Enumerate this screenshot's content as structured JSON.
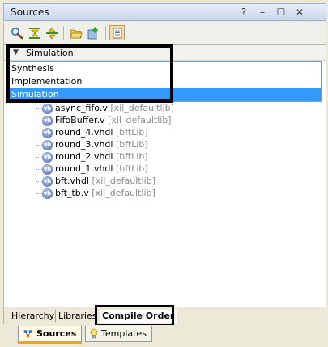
{
  "window": {
    "title": "Sources"
  },
  "title_buttons": {
    "help": "?",
    "minimize": "–",
    "maximize": "☐",
    "close": "✕"
  },
  "toolbar": {
    "icons": [
      "search-icon",
      "collapse-all-icon",
      "expand-all-icon",
      "open-folder-icon",
      "add-sources-icon",
      "properties-icon"
    ]
  },
  "dropdown": {
    "current": "Simulation",
    "options": [
      {
        "label": "Synthesis",
        "selected": false
      },
      {
        "label": "Implementation",
        "selected": false
      },
      {
        "label": "Simulation",
        "selected": true
      }
    ]
  },
  "files": [
    {
      "name": "async_fifo.v",
      "lib": "[xil_defaultlib]"
    },
    {
      "name": "FifoBuffer.v",
      "lib": "[xil_defaultlib]"
    },
    {
      "name": "round_4.vhdl",
      "lib": "[bftLib]"
    },
    {
      "name": "round_3.vhdl",
      "lib": "[bftLib]"
    },
    {
      "name": "round_2.vhdl",
      "lib": "[bftLib]"
    },
    {
      "name": "round_1.vhdl",
      "lib": "[bftLib]"
    },
    {
      "name": "bft.vhdl",
      "lib": "[xil_defaultlib]"
    },
    {
      "name": "bft_tb.v",
      "lib": "[xil_defaultlib]"
    }
  ],
  "file_icon_text": "vh",
  "bottom_tabs": {
    "hierarchy": "Hierarchy",
    "libraries": "Libraries",
    "compile_order": "Compile Order",
    "active": "Compile Order"
  },
  "view_tabs": {
    "sources": "Sources",
    "templates": "Templates",
    "active": "Sources"
  },
  "colors": {
    "selection": "#3399ff",
    "highlight_frame": "#000000",
    "active_tab_accent": "#f0a030"
  }
}
